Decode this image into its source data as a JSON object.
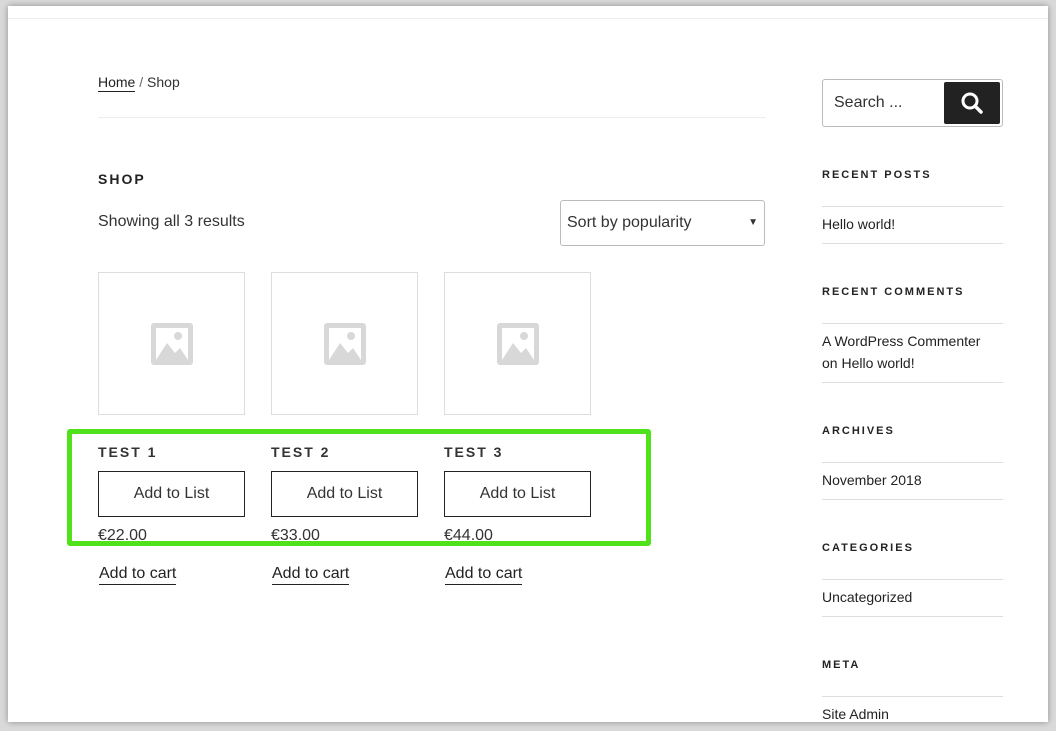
{
  "breadcrumb": {
    "home": "Home",
    "separator": "/",
    "current": "Shop"
  },
  "shop": {
    "title": "SHOP",
    "result_count": "Showing all 3 results",
    "sort_selected": "Sort by popularity",
    "products": [
      {
        "title": "TEST 1",
        "list_button": "Add to List",
        "price": "€22.00",
        "cart_link": "Add to cart"
      },
      {
        "title": "TEST 2",
        "list_button": "Add to List",
        "price": "€33.00",
        "cart_link": "Add to cart"
      },
      {
        "title": "TEST 3",
        "list_button": "Add to List",
        "price": "€44.00",
        "cart_link": "Add to cart"
      }
    ]
  },
  "sidebar": {
    "search_placeholder": "Search ...",
    "recent_posts": {
      "title": "RECENT POSTS",
      "items": [
        "Hello world!"
      ]
    },
    "recent_comments": {
      "title": "RECENT COMMENTS",
      "author": "A WordPress Commenter",
      "on": "on",
      "post": "Hello world!"
    },
    "archives": {
      "title": "ARCHIVES",
      "items": [
        "November 2018"
      ]
    },
    "categories": {
      "title": "CATEGORIES",
      "items": [
        "Uncategorized"
      ]
    },
    "meta": {
      "title": "META",
      "items": [
        "Site Admin"
      ]
    }
  },
  "colors": {
    "highlight": "#4fe21a",
    "search_button": "#222222",
    "border": "#bbbbbb"
  },
  "icons": {
    "search": "search-icon",
    "placeholder": "image-placeholder-icon",
    "dropdown": "chevron-down-icon"
  }
}
